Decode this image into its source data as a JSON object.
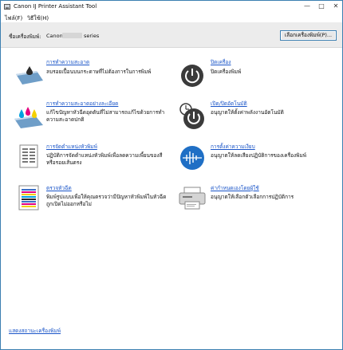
{
  "window": {
    "title": "Canon IJ Printer Assistant Tool"
  },
  "window_controls": {
    "minimize": "—",
    "maximize": "□",
    "close": "✕"
  },
  "menu": [
    {
      "label": "ไฟล์(F)"
    },
    {
      "label": "วิธีใช้(H)"
    }
  ],
  "printer": {
    "label": "ชื่อเครื่องพิมพ์:",
    "name": "Canon",
    "series": "series",
    "select_button": "เลือกเครื่องพิมพ์(P)..."
  },
  "items": [
    {
      "icon": "ink-tank-print-head-icon",
      "title": "การทำความสะอาด",
      "desc": [
        "ลบรอยเปื้อนบนกระดาษที่ไม่ต้องการในการพิมพ์"
      ]
    },
    {
      "icon": "power-off-icon",
      "title": "ปิดเครื่อง",
      "desc": [
        "ปิดเครื่องพิมพ์"
      ]
    },
    {
      "icon": "ink-deep-cleaning-icon",
      "title": "การทำความสะอาดอย่างละเอียด",
      "desc": [
        "แก้ไขปัญหาหัวฉีดอุดตันที่ไม่สามารถแก้ไขด้วยการทำ",
        "ความสะอาดปกติ"
      ]
    },
    {
      "icon": "auto-power-icon",
      "title": "เปิด/ปิดอัตโนมัติ",
      "desc": [
        "อนุญาตให้ตั้งค่าพลังงานอัตโนมัติ"
      ]
    },
    {
      "icon": "print-head-alignment-icon",
      "title": "การจัดตำแหน่งหัวพิมพ์",
      "desc": [
        "ปฏิบัติการจัดตำแหน่งหัวพิมพ์เพื่อลดความเพี้ยนของสี",
        "หรือรอยเส้นตรง"
      ]
    },
    {
      "icon": "quiet-setting-icon",
      "title": "การตั้งค่าความเงียบ",
      "desc": [
        "อนุญาตให้ลดเสียงปฏิบัติการของเครื่องพิมพ์"
      ]
    },
    {
      "icon": "nozzle-check-icon",
      "title": "ตรวจหัวฉีด",
      "desc": [
        "พิมพ์รูปแบบเพื่อให้คุณตรวจว่ามีปัญหาหัวพิมพ์ในหัวฉีด",
        "ถูกเปิดไม่ออกหรือไม่"
      ]
    },
    {
      "icon": "custom-settings-icon",
      "title": "ค่ากำหนดเองโดยผู้ใช้",
      "desc": [
        "อนุญาตให้เลือกตัวเลือกการปฏิบัติการ"
      ]
    }
  ],
  "footer": {
    "link": "แสดงสถานะเครื่องพิมพ์"
  },
  "colors": {
    "link": "#1a55c8",
    "accent_blue": "#1f6fc5",
    "power_dark": "#3b3b3b"
  }
}
